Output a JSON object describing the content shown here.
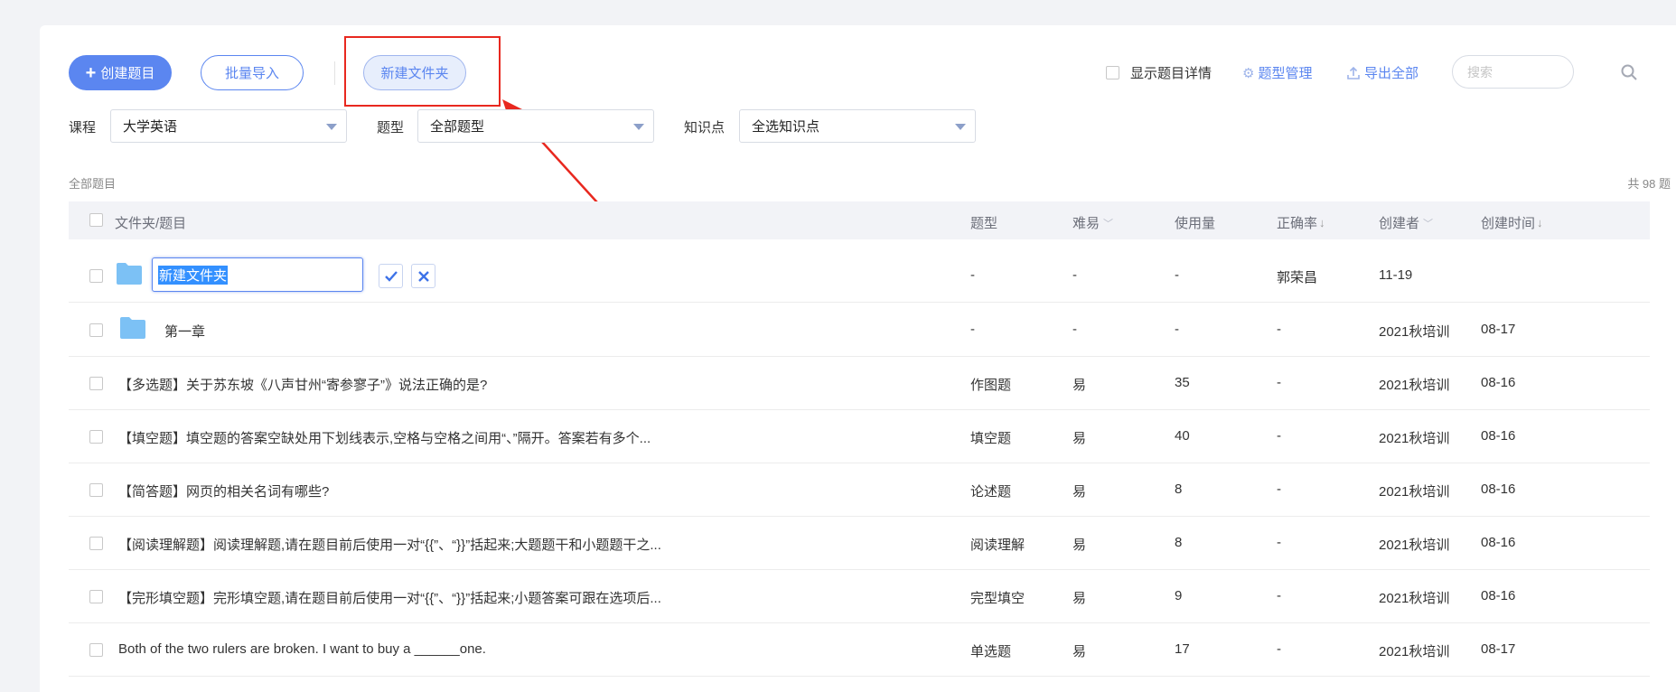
{
  "toolbar": {
    "create_label": "创建题目",
    "batch_import_label": "批量导入",
    "new_folder_label": "新建文件夹",
    "show_detail_label": "显示题目详情",
    "type_manage_label": "题型管理",
    "export_all_label": "导出全部",
    "search_placeholder": "搜索"
  },
  "filters": {
    "course_label": "课程",
    "course_value": "大学英语",
    "type_label": "题型",
    "type_value": "全部题型",
    "knowledge_label": "知识点",
    "knowledge_value": "全选知识点"
  },
  "list": {
    "section_title": "全部题目",
    "total_text": "共 98 题",
    "columns": {
      "title": "文件夹/题目",
      "type": "题型",
      "difficulty": "难易",
      "usage": "使用量",
      "accuracy": "正确率",
      "creator": "创建者",
      "created": "创建时间"
    },
    "editing_row": {
      "input_value": "新建文件夹",
      "type": "-",
      "difficulty": "-",
      "usage": "-",
      "accuracy": "郭荣昌",
      "creator": "11-19"
    },
    "rows": [
      {
        "title": "第一章",
        "type": "-",
        "difficulty": "-",
        "usage": "-",
        "accuracy": "-",
        "creator": "2021秋培训",
        "created": "08-17"
      },
      {
        "title": "【多选题】关于苏东坡《八声甘州“寄参寥子”》说法正确的是?",
        "type": "作图题",
        "difficulty": "易",
        "usage": "35",
        "accuracy": "-",
        "creator": "2021秋培训",
        "created": "08-16"
      },
      {
        "title": "【填空题】填空题的答案空缺处用下划线表示,空格与空格之间用“、”隔开。答案若有多个...",
        "type": "填空题",
        "difficulty": "易",
        "usage": "40",
        "accuracy": "-",
        "creator": "2021秋培训",
        "created": "08-16"
      },
      {
        "title": "【简答题】网页的相关名词有哪些?",
        "type": "论述题",
        "difficulty": "易",
        "usage": "8",
        "accuracy": "-",
        "creator": "2021秋培训",
        "created": "08-16"
      },
      {
        "title": "【阅读理解题】阅读理解题,请在题目前后使用一对“{{”、“}}”括起来;大题题干和小题题干之...",
        "type": "阅读理解",
        "difficulty": "易",
        "usage": "8",
        "accuracy": "-",
        "creator": "2021秋培训",
        "created": "08-16"
      },
      {
        "title": "【完形填空题】完形填空题,请在题目前后使用一对“{{”、“}}”括起来;小题答案可跟在选项后...",
        "type": "完型填空",
        "difficulty": "易",
        "usage": "9",
        "accuracy": "-",
        "creator": "2021秋培训",
        "created": "08-16"
      },
      {
        "title": "Both of the two rulers are broken. I want to buy a ______one.",
        "type": "单选题",
        "difficulty": "易",
        "usage": "17",
        "accuracy": "-",
        "creator": "2021秋培训",
        "created": "08-17"
      }
    ]
  },
  "icons": {
    "folder_color": "#7cc1f5",
    "accent": "#5b86f0",
    "highlight": "#e8281f"
  }
}
